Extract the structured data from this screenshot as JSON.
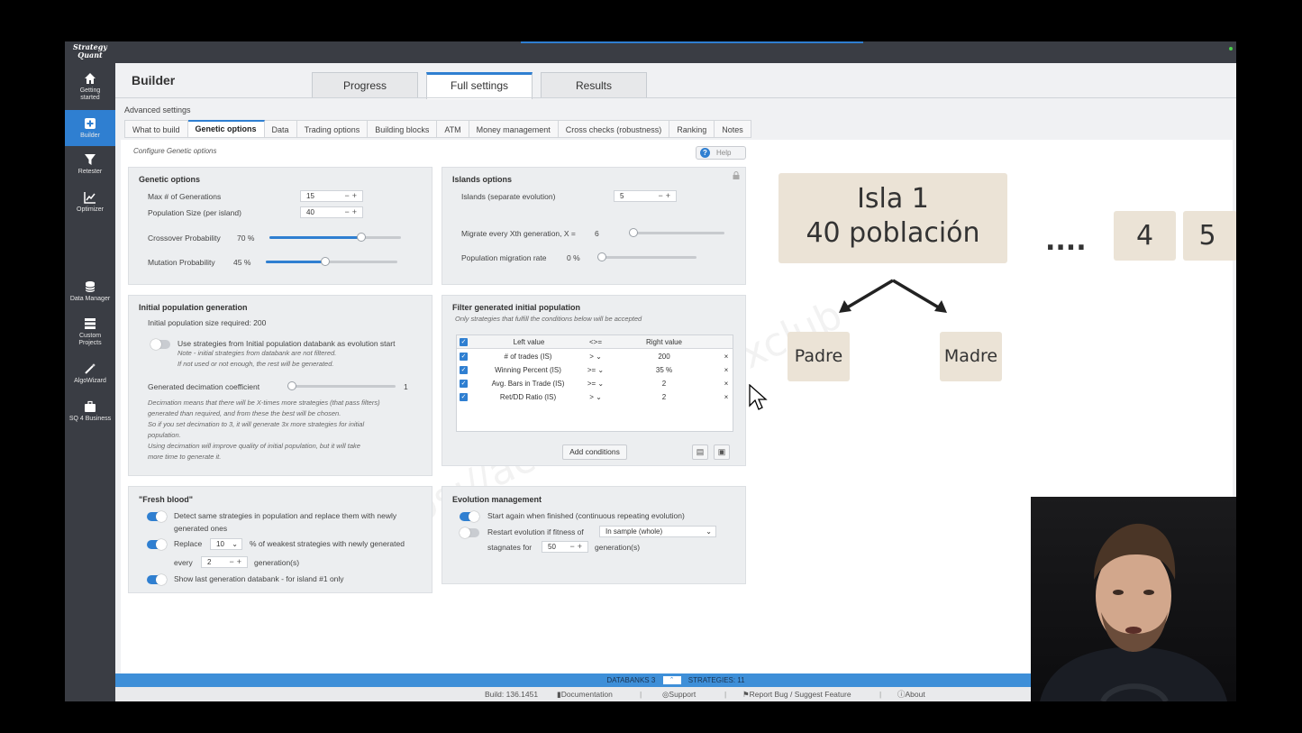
{
  "app": {
    "logo": [
      "Strategy",
      "Quant"
    ],
    "title": "Builder",
    "accent": "#2f7fd1"
  },
  "sidebar": {
    "items": [
      {
        "icon": "home-icon",
        "label": [
          "Getting",
          "started"
        ]
      },
      {
        "icon": "plus-square-icon",
        "label": [
          "Builder"
        ],
        "active": true
      },
      {
        "icon": "filter-icon",
        "label": [
          "Retester"
        ]
      },
      {
        "icon": "chart-icon",
        "label": [
          "Optimizer"
        ]
      },
      {
        "icon": "database-icon",
        "label": [
          "Data Manager"
        ]
      },
      {
        "icon": "list-icon",
        "label": [
          "Custom",
          "Projects"
        ]
      },
      {
        "icon": "wand-icon",
        "label": [
          "AlgoWizard"
        ]
      },
      {
        "icon": "briefcase-icon",
        "label": [
          "SQ 4 Business"
        ]
      }
    ]
  },
  "tabs": {
    "main": [
      "Progress",
      "Full settings",
      "Results"
    ],
    "active_main": "Full settings",
    "advanced_label": "Advanced settings",
    "sub": [
      "What to build",
      "Genetic options",
      "Data",
      "Trading options",
      "Building blocks",
      "ATM",
      "Money management",
      "Cross checks (robustness)",
      "Ranking",
      "Notes"
    ],
    "active_sub": "Genetic options"
  },
  "configure": "Configure Genetic options",
  "help_label": "Help",
  "genetic": {
    "title": "Genetic options",
    "max_gen_label": "Max # of Generations",
    "max_gen": "15",
    "pop_label": "Population Size (per island)",
    "pop": "40",
    "crossover_label": "Crossover Probability",
    "crossover": "70 %",
    "crossover_value": 0.7,
    "mutation_label": "Mutation Probability",
    "mutation": "45 %",
    "mutation_value": 0.45
  },
  "islands": {
    "title": "Islands options",
    "islands_label": "Islands (separate evolution)",
    "islands": "5",
    "migrate_label": "Migrate every Xth generation, X =",
    "migrate": "6",
    "rate_label": "Population migration rate",
    "rate": "0 %"
  },
  "initial": {
    "title": "Initial population generation",
    "size_text": "Initial population size required: 200",
    "use_label": "Use strategies from Initial population databank as evolution start",
    "note1": "Note - initial strategies from databank are not filtered.",
    "note2": "If not used or not enough, the rest will be generated.",
    "decimation_label": "Generated decimation coefficient",
    "decimation": "1",
    "desc": [
      "Decimation means that there will be X-times more strategies (that pass filters)",
      "generated than required, and from these the best will be chosen.",
      "So if you set decimation to 3, it will generate 3x more strategies for initial",
      "population.",
      "Using decimation will improve quality of initial population, but it will take",
      "more time to generate it."
    ]
  },
  "filter": {
    "title": "Filter generated initial population",
    "subtitle": "Only strategies that fulfill the conditions below will be accepted",
    "headers": [
      "Left value",
      "<>=",
      "Right value"
    ],
    "rows": [
      {
        "left": "# of trades (IS)",
        "op": ">",
        "right": "200"
      },
      {
        "left": "Winning Percent (IS)",
        "op": ">=",
        "right": "35 %"
      },
      {
        "left": "Avg. Bars in Trade (IS)",
        "op": ">=",
        "right": "2"
      },
      {
        "left": "Ret/DD Ratio (IS)",
        "op": ">",
        "right": "2"
      }
    ],
    "add_label": "Add conditions"
  },
  "fresh": {
    "title": "\"Fresh blood\"",
    "detect_label": "Detect same strategies in population and replace them with newly",
    "detect_label2": "generated ones",
    "replace_label": "Replace",
    "replace": "10",
    "replace_suffix": "% of weakest strategies with newly generated",
    "every_label": "every",
    "every": "2",
    "gen_label": "generation(s)",
    "show_label": "Show last generation databank - for island #1 only"
  },
  "evolution": {
    "title": "Evolution management",
    "start_label": "Start again when finished (continuous repeating evolution)",
    "restart_label": "Restart evolution if fitness of",
    "restart_select": "In sample (whole)",
    "stagnates_label": "stagnates for",
    "stagnates": "50",
    "gen_label": "generation(s)"
  },
  "diagram": {
    "island_line1": "Isla 1",
    "island_line2": "40 población",
    "dots": "....",
    "box4": "4",
    "box5": "5",
    "padre": "Padre",
    "madre": "Madre",
    "watermark": "https://academia.imoxclub"
  },
  "status": {
    "databanks": "DATABANKS 3",
    "strategies": "STRATEGIES: 11"
  },
  "footer": {
    "build": "Build: 136.1451",
    "docs": "Documentation",
    "support": "Support",
    "report": "Report Bug / Suggest Feature",
    "about": "About"
  }
}
